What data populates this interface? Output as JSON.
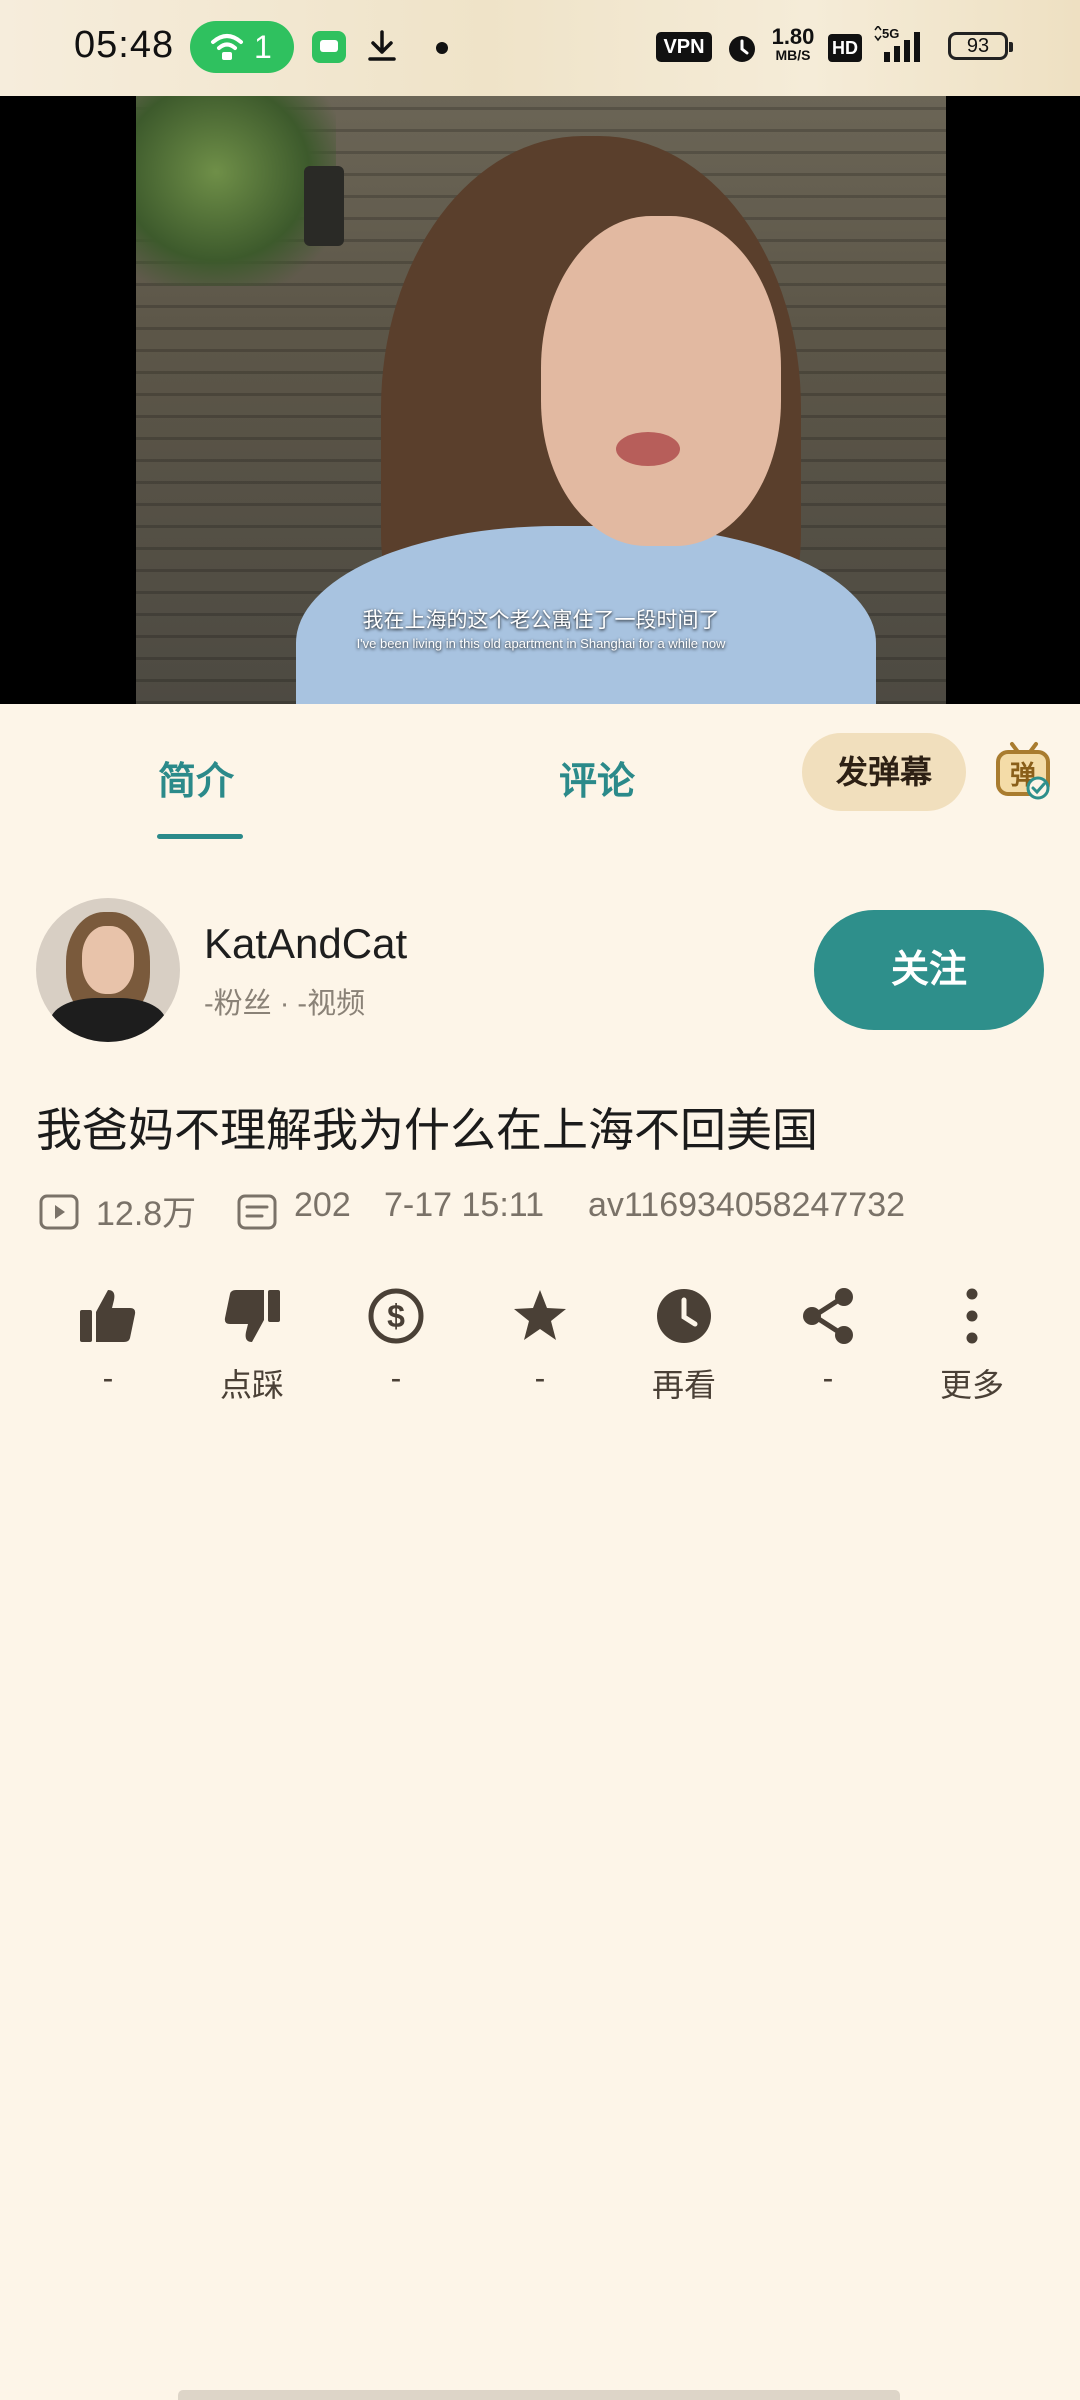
{
  "status_bar": {
    "time": "05:48",
    "wifi_count": "1",
    "vpn": "VPN",
    "speed_value": "1.80",
    "speed_unit": "MB/S",
    "hd": "HD",
    "battery": "93"
  },
  "video": {
    "subtitle_zh": "我在上海的这个老公寓住了一段时间了",
    "subtitle_en": "I've been living in this old apartment in Shanghai for a while now"
  },
  "tabs": {
    "intro": "简介",
    "comments": "评论",
    "send_danmu": "发弹幕"
  },
  "uploader": {
    "name": "KatAndCat",
    "stats": "-粉丝 · -视频",
    "follow": "关注"
  },
  "video_info": {
    "title": "我爸妈不理解我为什么在上海不回美国",
    "views": "12.8万",
    "danmu_count": "202",
    "date": "7-17 15:11",
    "av_id": "av116934058247732"
  },
  "actions": [
    {
      "icon": "thumbs-up-icon",
      "label": "-"
    },
    {
      "icon": "thumbs-down-icon",
      "label": "点踩"
    },
    {
      "icon": "coin-icon",
      "label": "-"
    },
    {
      "icon": "star-icon",
      "label": "-"
    },
    {
      "icon": "clock-icon",
      "label": "再看"
    },
    {
      "icon": "share-icon",
      "label": "-"
    },
    {
      "icon": "more-icon",
      "label": "更多"
    }
  ],
  "colors": {
    "accent": "#2e8f8b",
    "background": "#fdf5e8",
    "danmu_button": "#f1dfbd"
  }
}
